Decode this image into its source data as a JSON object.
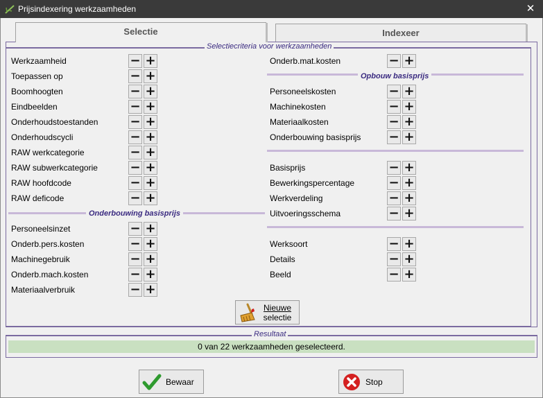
{
  "window": {
    "title": "Prijsindexering werkzaamheden",
    "close_glyph": "✕"
  },
  "tabs": {
    "selectie": "Selectie",
    "indexeer": "Indexeer"
  },
  "selection": {
    "group_title": "Selectiecriteria voor werkzaamheden",
    "left_items": [
      "Werkzaamheid",
      "Toepassen op",
      "Boomhoogten",
      "Eindbeelden",
      "Onderhoudstoestanden",
      "Onderhoudscycli",
      "RAW werkcategorie",
      "RAW subwerkcategorie",
      "RAW hoofdcode",
      "RAW deficode"
    ],
    "left_section": "Onderbouwing basisprijs",
    "left_section_items": [
      "Personeelsinzet",
      "Onderb.pers.kosten",
      "Machinegebruik",
      "Onderb.mach.kosten",
      "Materiaalverbruik"
    ],
    "right_first": "Onderb.mat.kosten",
    "right_section": "Opbouw basisprijs",
    "right_section_items": [
      "Personeelskosten",
      "Machinekosten",
      "Materiaalkosten",
      "Onderbouwing basisprijs"
    ],
    "right_group2": [
      "Basisprijs",
      "Bewerkingspercentage",
      "Werkverdeling",
      "Uitvoeringsschema"
    ],
    "right_group3": [
      "Werksoort",
      "Details",
      "Beeld"
    ],
    "minus": "−",
    "plus": "+",
    "new_selection_line1": "Nieuwe",
    "new_selection_line2": "selectie"
  },
  "result": {
    "title": "Resultaat",
    "text": "0 van 22 werkzaamheden geselecteerd."
  },
  "buttons": {
    "save": "Bewaar",
    "stop": "Stop"
  },
  "colors": {
    "result_bg": "#c9e0c1",
    "accent": "#3a2a80",
    "ok_green": "#2e9a2e",
    "stop_red": "#d42020"
  }
}
